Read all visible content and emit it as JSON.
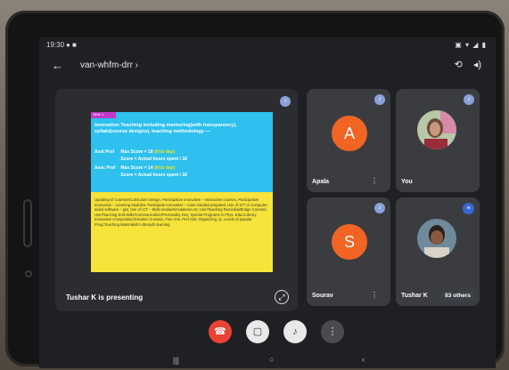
{
  "status_bar": {
    "time": "19:30",
    "notif_icons": "● ■",
    "right_icons": "▣ ▾ ◢ ▮"
  },
  "title_bar": {
    "back_glyph": "←",
    "meeting_code": "van-whfm-drr ›",
    "switch_camera_glyph": "⟲",
    "speaker_glyph": "◂)"
  },
  "presentation": {
    "presenting_label": "Tushar K is presenting",
    "slide": {
      "tag": "Slide 1",
      "heading": "Innovation Teaching including mentoring(with transparency), syllabi(course designs), teaching methodology —",
      "rows": [
        {
          "label": "Asst Prof",
          "text": "Max Score = 18",
          "highlight": "(Hrs/ day)"
        },
        {
          "label": "",
          "text": "Score = Actual hours spent / 18",
          "highlight": ""
        },
        {
          "label": "Assc Prof",
          "text": "Max Score = 14",
          "highlight": "(Hrs/ day)"
        },
        {
          "label": "",
          "text": "Score = Actual hours spent / 18",
          "highlight": ""
        }
      ],
      "body": "Updating of Courses/Curriculum Design, Participative Innovative – Interactive courses, Participative Innovative – Learning Modules, Participate Innovative – Case Studies prepared; Use of ICT or Computer-aided software – ppt; Use of ICT – Multi-media/Simulations etc; Use/Teaching Remedial/Bridge Courses; Use/Teaching Soft-skills/Communication/Personality Dev; Special Programs in Phys. Educ/Library; Innovative Composition/Creation in Music, Fine Arts, Perf Arts; Organizing, Q. Levels of popular Prog./Teaching Materials/E-Library/E-learning"
    }
  },
  "participants": [
    {
      "name": "Apala",
      "initial": "A",
      "avatar_color": "#f26422"
    },
    {
      "name": "You"
    },
    {
      "name": "Sourav",
      "initial": "S",
      "avatar_color": "#f26422"
    },
    {
      "name": "Tushar K",
      "others": "83 others"
    }
  ],
  "controls": {
    "end_call_glyph": "☎",
    "camera_glyph": "▢",
    "mic_glyph": "♪",
    "more_glyph": "⋮"
  },
  "navbar": {
    "recent_glyph": "|||",
    "home_glyph": "○",
    "back_glyph": "‹"
  },
  "colors": {
    "slide_blue": "#2ec0ee",
    "slide_yellow": "#f7e33a",
    "avatar_orange": "#f26422",
    "end_call_red": "#ea4335"
  }
}
